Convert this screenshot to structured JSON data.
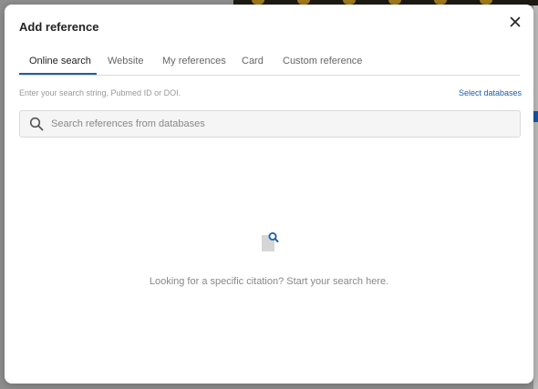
{
  "dialog": {
    "title": "Add reference",
    "close_icon": "close-icon"
  },
  "tabs": [
    {
      "label": "Online search",
      "active": true
    },
    {
      "label": "Website",
      "active": false
    },
    {
      "label": "My references",
      "active": false
    },
    {
      "label": "Card",
      "active": false
    },
    {
      "label": "Custom reference",
      "active": false
    }
  ],
  "search": {
    "hint": "Enter your search string, Pubmed ID or DOI.",
    "select_databases_label": "Select databases",
    "placeholder": "Search references from databases",
    "value": "",
    "icon": "search-icon"
  },
  "empty_state": {
    "icon": "document-search-icon",
    "message": "Looking for a specific citation? Start your search here."
  },
  "colors": {
    "accent": "#1a5fa6",
    "backdrop": "#8f8f8f"
  }
}
